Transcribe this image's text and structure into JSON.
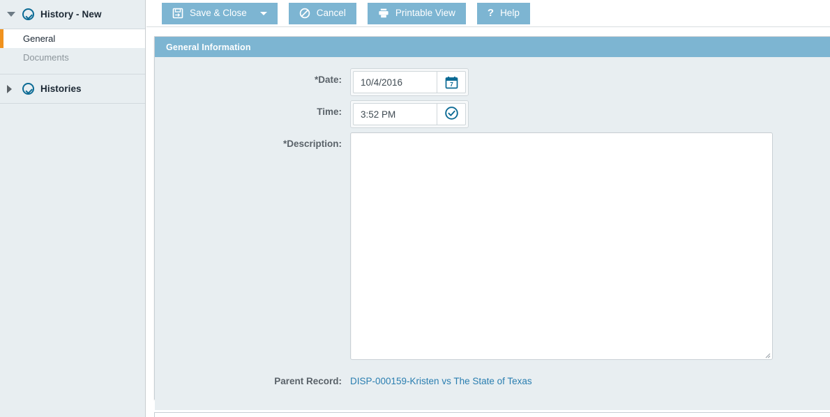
{
  "sidebar": {
    "groups": [
      {
        "name": "history-new",
        "title": "History - New",
        "expanded": true,
        "twisty_icon": "chevron-down-icon",
        "status_icon": "check-circle-icon",
        "items": [
          {
            "label": "General",
            "active": true
          },
          {
            "label": "Documents",
            "active": false
          }
        ]
      },
      {
        "name": "histories",
        "title": "Histories",
        "expanded": false,
        "twisty_icon": "chevron-right-icon",
        "status_icon": "check-circle-icon",
        "items": []
      }
    ]
  },
  "toolbar": {
    "buttons": [
      {
        "name": "save-and-close",
        "label": "Save & Close",
        "icon": "save-icon",
        "has_caret": true
      },
      {
        "name": "cancel",
        "label": "Cancel",
        "icon": "cancel-icon",
        "has_caret": false
      },
      {
        "name": "printable-view",
        "label": "Printable View",
        "icon": "printer-icon",
        "has_caret": false
      },
      {
        "name": "help",
        "label": "Help",
        "icon": "question-mark-icon",
        "has_caret": false
      }
    ]
  },
  "panel": {
    "header": "General Information",
    "fields": {
      "date": {
        "label": "*Date:",
        "value": "10/4/2016",
        "placeholder": "",
        "button_icon": "calendar-icon"
      },
      "time": {
        "label": "Time:",
        "value": "3:52 PM",
        "placeholder": "",
        "button_icon": "clock-check-icon"
      },
      "description": {
        "label": "*Description:",
        "value": "",
        "placeholder": ""
      },
      "parent_record": {
        "label": "Parent Record:",
        "value": "DISP-000159-Kristen vs The State of Texas"
      }
    }
  },
  "colors": {
    "accent_blue": "#7db5d2",
    "link_blue": "#2a7eb0",
    "icon_teal": "#0b6a94",
    "active_marker_orange": "#f0921e",
    "panel_bg": "#e8eef1"
  }
}
